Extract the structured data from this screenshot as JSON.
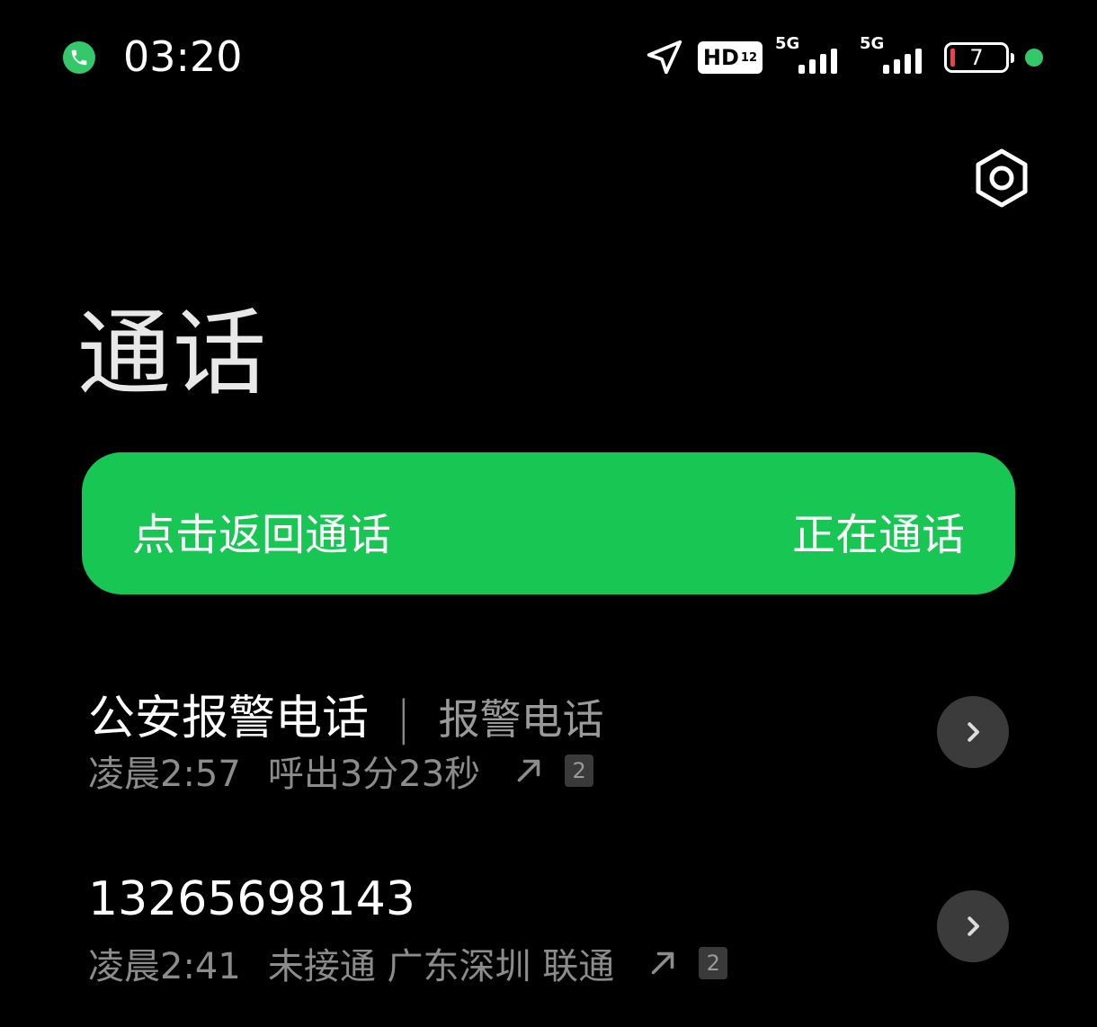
{
  "status_bar": {
    "time": "03:20",
    "hd_label": "HD",
    "hd_sub": "12",
    "sim1_tech": "5G",
    "sim2_tech": "5G",
    "battery_level": "7",
    "accent_color": "#35c86a"
  },
  "header": {
    "title": "通话",
    "settings_icon": "gear-icon"
  },
  "call_banner": {
    "left_label": "点击返回通话",
    "right_label": "正在通话",
    "background": "#17c653"
  },
  "call_log": [
    {
      "name": "公安报警电话",
      "tag": "报警电话",
      "time": "凌晨2:57",
      "detail": "呼出3分23秒",
      "sim": "2"
    },
    {
      "name": "13265698143",
      "tag": "",
      "time": "凌晨2:41",
      "detail": "未接通 广东深圳 联通",
      "sim": "2"
    }
  ]
}
